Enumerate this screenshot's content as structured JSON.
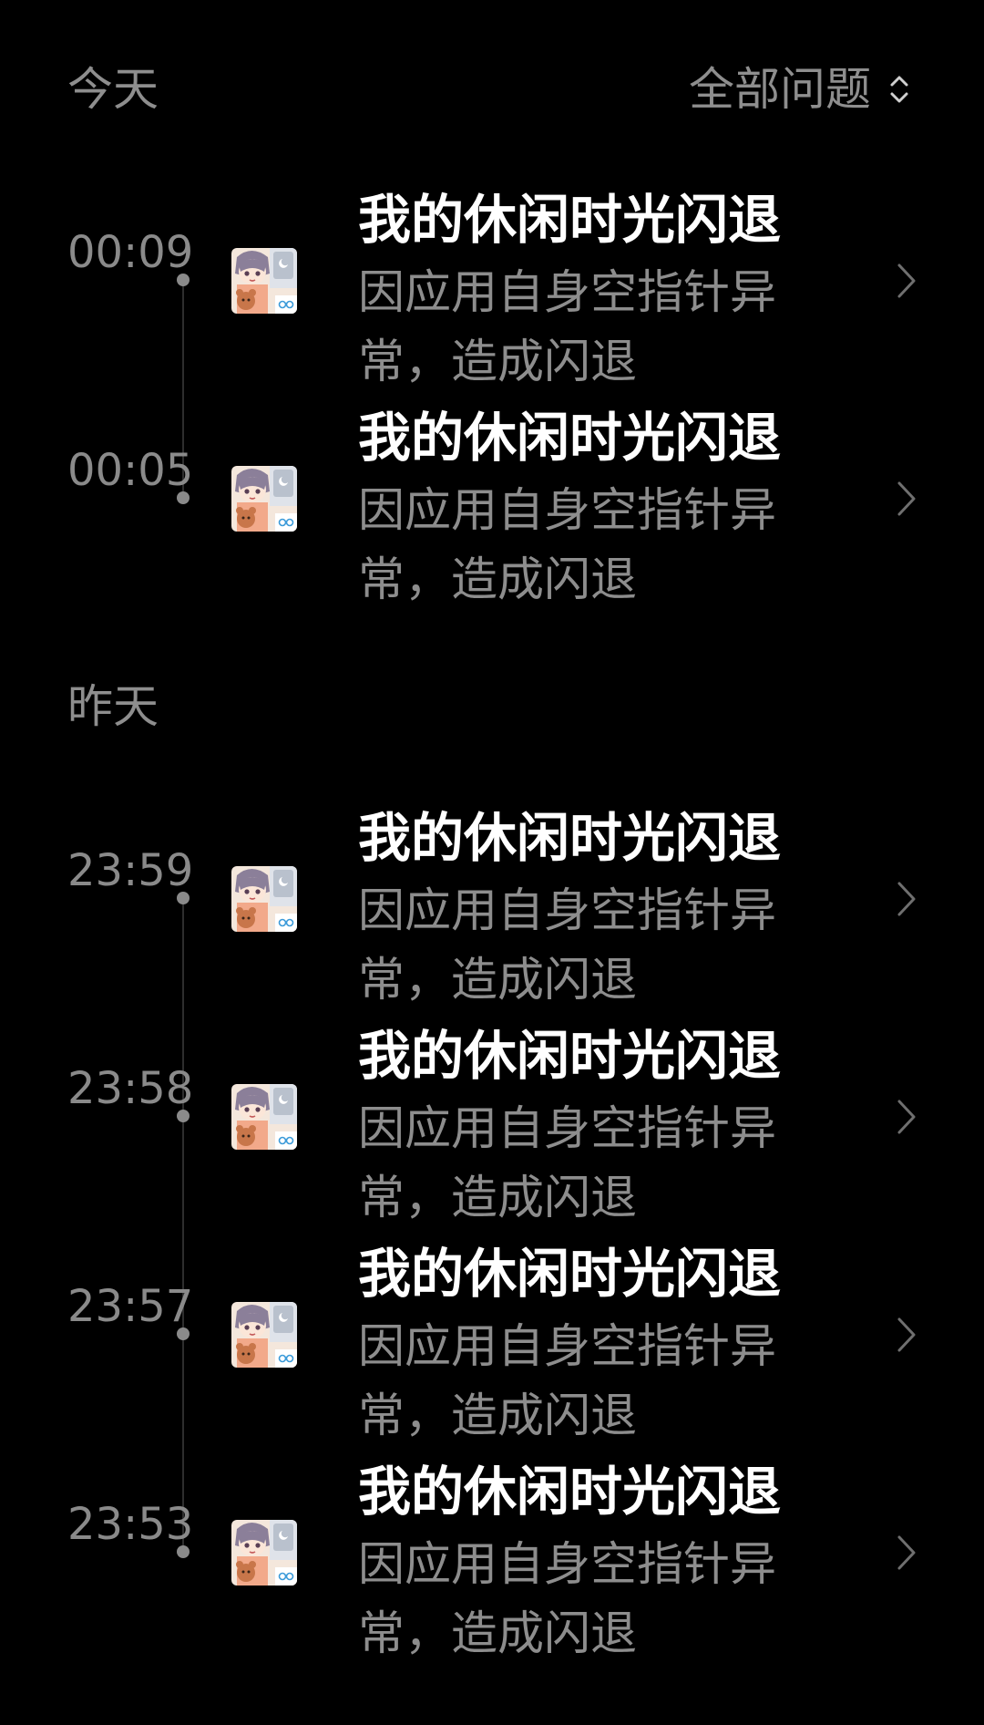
{
  "header": {
    "today_label": "今天",
    "filter_label": "全部问题",
    "filter_icon": "sort-updown-icon"
  },
  "sections": {
    "yesterday_label": "昨天"
  },
  "colors": {
    "background": "#000000",
    "title": "#ffffff",
    "secondary": "#8d8d8d",
    "timeline": "#2e2e2e"
  },
  "entries": [
    {
      "time": "00:09",
      "title": "我的休闲时光闪退",
      "desc": "因应用自身空指针异常，造成闪退"
    },
    {
      "time": "00:05",
      "title": "我的休闲时光闪退",
      "desc": "因应用自身空指针异常，造成闪退"
    },
    {
      "time": "23:59",
      "title": "我的休闲时光闪退",
      "desc": "因应用自身空指针异常，造成闪退"
    },
    {
      "time": "23:58",
      "title": "我的休闲时光闪退",
      "desc": "因应用自身空指针异常，造成闪退"
    },
    {
      "time": "23:57",
      "title": "我的休闲时光闪退",
      "desc": "因应用自身空指针异常，造成闪退"
    },
    {
      "time": "23:53",
      "title": "我的休闲时光闪退",
      "desc": "因应用自身空指针异常，造成闪退"
    }
  ]
}
